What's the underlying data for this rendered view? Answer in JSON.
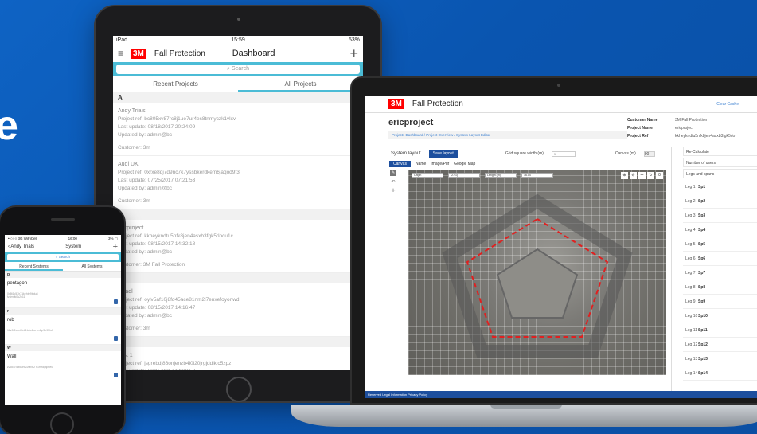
{
  "hero_letter": "e",
  "ipad": {
    "status": {
      "carrier": "iPad",
      "time": "15:59",
      "battery": "53%"
    },
    "brand_logo": "3M",
    "brand_name": "Fall Protection",
    "title": "Dashboard",
    "search_placeholder": "Search",
    "tabs": [
      "Recent Projects",
      "All Projects"
    ],
    "sections": [
      {
        "letter": "A",
        "projects": [
          {
            "name": "Andy Trials",
            "ref": "Project ref:  bc805xv87rc8j1ue7ur4es8tnmyczk1vlxv",
            "updated": "Last update: 08/18/2017 20:24:09",
            "by": "Updated by: admin@bc",
            "customer": "Customer:  3m"
          },
          {
            "name": "Audi UK",
            "ref": "Project ref:  0xrxe8dj7d9nc7k7yssbkerdkem6jaqod9f3",
            "updated": "Last update: 07/25/2017 07:21:53",
            "by": "Updated by: admin@bc",
            "customer": "Customer:  3m"
          }
        ]
      },
      {
        "letter": "e",
        "projects": [
          {
            "name": "ericproject",
            "ref": "Project ref:  kkheykndtu5nfk8jen4asxb3fgk5rlocu1c",
            "updated": "Last update: 08/15/2017 14:32:18",
            "by": "Updated by: admin@bc",
            "customer": "Customer:  3M Fall Protection"
          }
        ]
      },
      {
        "letter": "a",
        "projects": [
          {
            "name": "fulfadl",
            "ref": "Project ref:  oylv5af10j8fd45ace81nm2l7enxefoyonwd",
            "updated": "Last update: 08/15/2017 14:16:47",
            "by": "Updated by: admin@bc",
            "customer": "Customer:  3m"
          }
        ]
      },
      {
        "letter": "T",
        "projects": [
          {
            "name": "Test 1",
            "ref": "Project ref:  jsgrebdj86onjenzb4l0i20jrgjddlkjc5zpz",
            "updated": "Last update: 08/15/2017 14:00:53",
            "by": "Updated by: admin@bc",
            "customer": "Customer:  Test1"
          }
        ]
      }
    ]
  },
  "laptop": {
    "brand_logo": "3M",
    "brand_name": "Fall Protection",
    "clear_cache": "Clear Cache",
    "project_title": "ericproject",
    "breadcrumb": "Projects Dashboard  /  Project Overview  /  System Layout Editor",
    "meta": [
      {
        "k": "Customer Name",
        "v": "3M Fall Protection"
      },
      {
        "k": "Project Name",
        "v": "ericproject"
      },
      {
        "k": "Project Ref",
        "v": "kkheykndtu5nfk8jen4asxb3fgk5rlo"
      }
    ],
    "toolbar": {
      "label": "System layout",
      "save": "Save layout",
      "grid_label": "Grid square width (m)",
      "grid_value": "5",
      "canvas_label": "Canvas (m)",
      "canvas_value": "90"
    },
    "editor_tabs": [
      "Canvas",
      "Name",
      "Image/Pdf",
      "Google Map"
    ],
    "canvas_inputs": [
      "Origin",
      "(27.1)",
      "Length (m)",
      "16.04"
    ],
    "zoom_value": "0",
    "legs_header": "Re-Calculate",
    "legs_sub": "Number of users",
    "legs_title": "Legs and spans",
    "legs": [
      {
        "n": "Leg 1",
        "s": "Sp1"
      },
      {
        "n": "Leg 2",
        "s": "Sp2"
      },
      {
        "n": "Leg 3",
        "s": "Sp3"
      },
      {
        "n": "Leg 4",
        "s": "Sp4"
      },
      {
        "n": "Leg 5",
        "s": "Sp5"
      },
      {
        "n": "Leg 6",
        "s": "Sp6"
      },
      {
        "n": "Leg 7",
        "s": "Sp7"
      },
      {
        "n": "Leg 8",
        "s": "Sp8"
      },
      {
        "n": "Leg 9",
        "s": "Sp9"
      },
      {
        "n": "Leg 10",
        "s": "Sp10"
      },
      {
        "n": "Leg 11",
        "s": "Sp11"
      },
      {
        "n": "Leg 12",
        "s": "Sp12"
      },
      {
        "n": "Leg 13",
        "s": "Sp13"
      },
      {
        "n": "Leg 14",
        "s": "Sp14"
      }
    ],
    "footer": "Reserved   Legal Information   Privacy Policy"
  },
  "iphone": {
    "status": {
      "carrier": "••○○○ 3G WiFiCell",
      "time": "16:00",
      "battery": "3% ▢"
    },
    "back": "Andy Trials",
    "title": "System",
    "search": "Search",
    "tabs": [
      "Recent Systems",
      "All Systems"
    ],
    "sections": [
      {
        "letter": "p",
        "items": [
          {
            "name": "pentagon",
            "id": "0x8t1c53h71kehbr9bdu8 fz5m9k0u2v11"
          }
        ]
      },
      {
        "letter": "r",
        "items": [
          {
            "name": "rob",
            "id": "18z5f2xde6fek1b4e4oe m4qr5b95fo0"
          }
        ]
      },
      {
        "letter": "W",
        "items": [
          {
            "name": "Wall",
            "id": "z2o51r4rbd0hf22tfbxt2 h1f9n8j8p6e0"
          }
        ]
      }
    ]
  },
  "colors": {
    "background": "#0b57b2",
    "accent_cyan": "#4bbcd6",
    "brand_red": "#ff0000",
    "primary_blue": "#1d4f9e"
  }
}
